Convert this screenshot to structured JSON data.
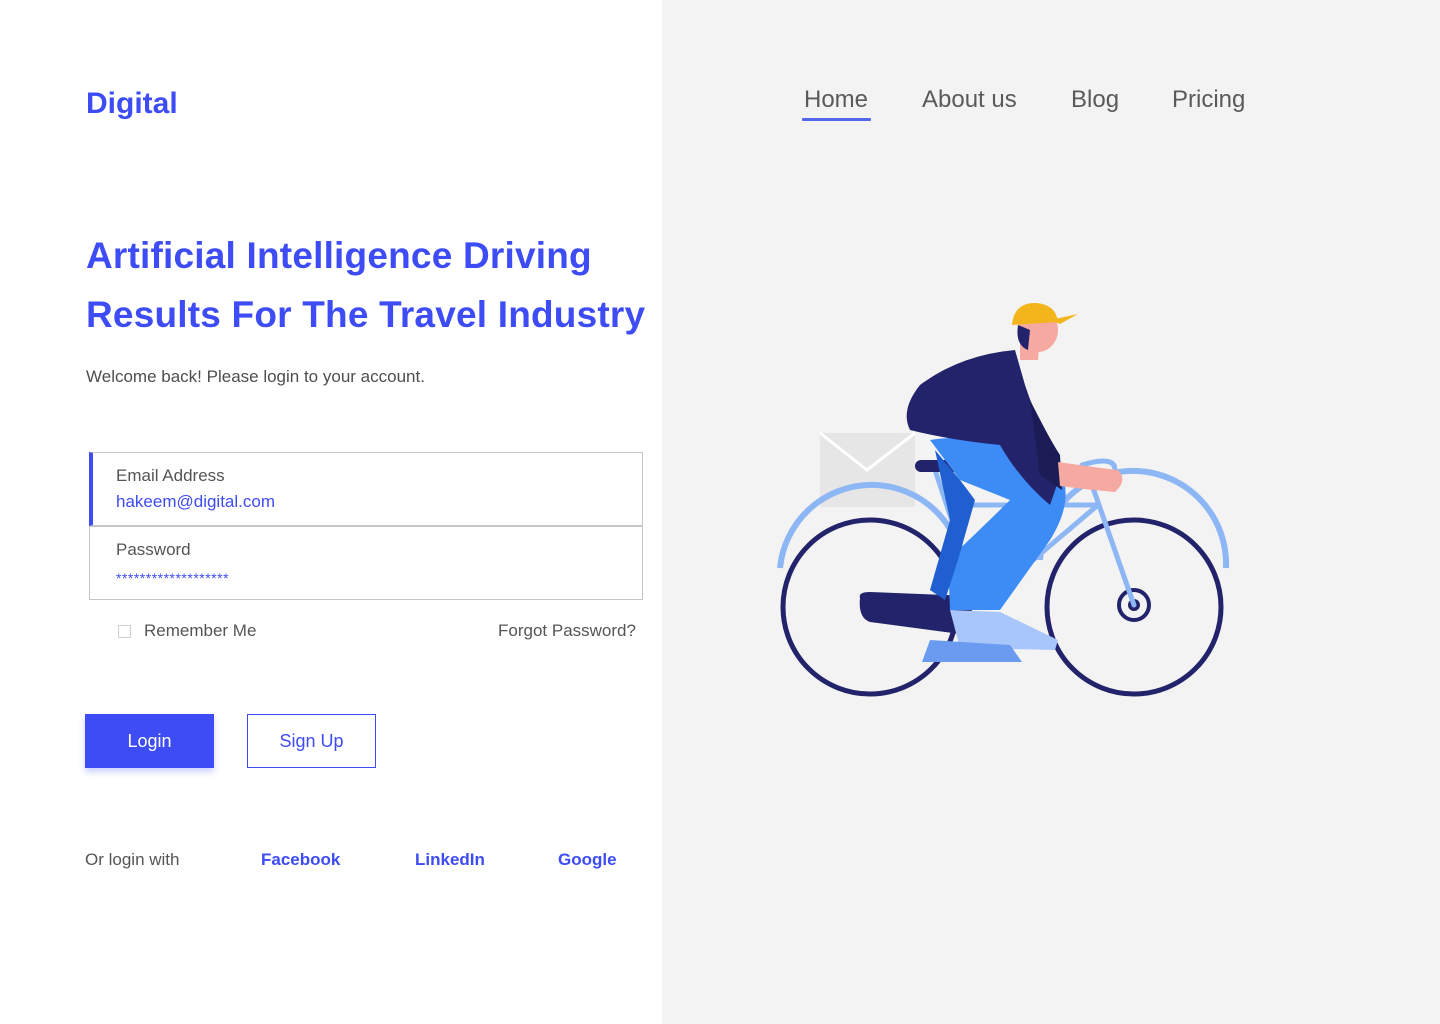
{
  "brand": {
    "logo": "Digital"
  },
  "nav": {
    "items": [
      {
        "label": "Home",
        "active": true
      },
      {
        "label": "About us"
      },
      {
        "label": "Blog"
      },
      {
        "label": "Pricing"
      }
    ]
  },
  "hero": {
    "headline_line1": "Artificial Intelligence Driving",
    "headline_line2": "Results For The Travel Industry",
    "subtitle": "Welcome  back! Please login to your account."
  },
  "form": {
    "email": {
      "label": "Email Address",
      "value": "hakeem@digital.com"
    },
    "password": {
      "label": "Password",
      "value": "*******************"
    },
    "remember_label": "Remember Me",
    "forgot_label": "Forgot Password?",
    "login_label": "Login",
    "signup_label": "Sign Up"
  },
  "social": {
    "label": "Or login with",
    "providers": [
      "Facebook",
      "LinkedIn",
      "Google"
    ]
  },
  "colors": {
    "accent": "#3d4cf5",
    "panel_bg": "#f3f3f3",
    "text_muted": "#555555"
  },
  "illustration": {
    "icon": "cyclist-with-envelope-illustration"
  }
}
